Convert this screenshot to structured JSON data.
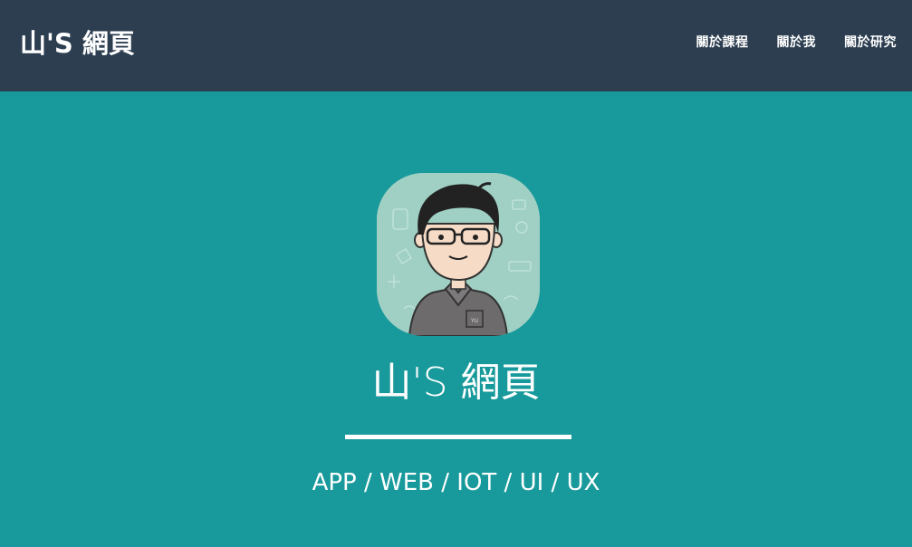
{
  "navbar": {
    "brand": "山'S 網頁",
    "links": [
      {
        "label": "關於課程"
      },
      {
        "label": "關於我"
      },
      {
        "label": "關於研究"
      }
    ]
  },
  "hero": {
    "title": "山'S 網頁",
    "subtitle": "APP / WEB / IOT / UI / UX",
    "avatar_badge": "YU"
  },
  "colors": {
    "navbar_bg": "#2c3e50",
    "hero_bg": "#18999b",
    "avatar_bg": "#9fd0c3",
    "text": "#ffffff"
  }
}
